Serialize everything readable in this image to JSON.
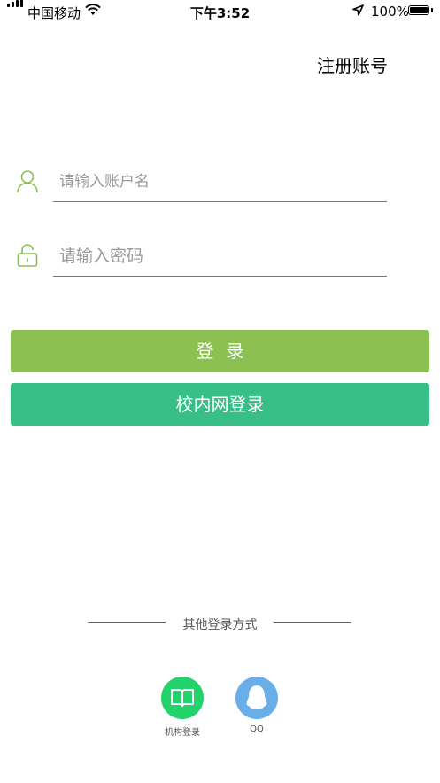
{
  "status_bar": {
    "carrier": "中国移动",
    "time": "下午3:52",
    "battery": "100%"
  },
  "header": {
    "register_label": "注册账号"
  },
  "form": {
    "username_placeholder": "请输入账户名",
    "password_placeholder": "请输入密码",
    "login_label": "登录",
    "campus_login_label": "校内网登录"
  },
  "other_login": {
    "title": "其他登录方式",
    "options": [
      {
        "label": "机构登录",
        "icon": "book-icon",
        "color": "#22d36b"
      },
      {
        "label": "QQ",
        "icon": "qq-penguin-icon",
        "color": "#6aaee9"
      }
    ]
  },
  "colors": {
    "accent_green": "#8cc152",
    "campus_green": "#37bf86",
    "icon_green": "#8cc152"
  }
}
